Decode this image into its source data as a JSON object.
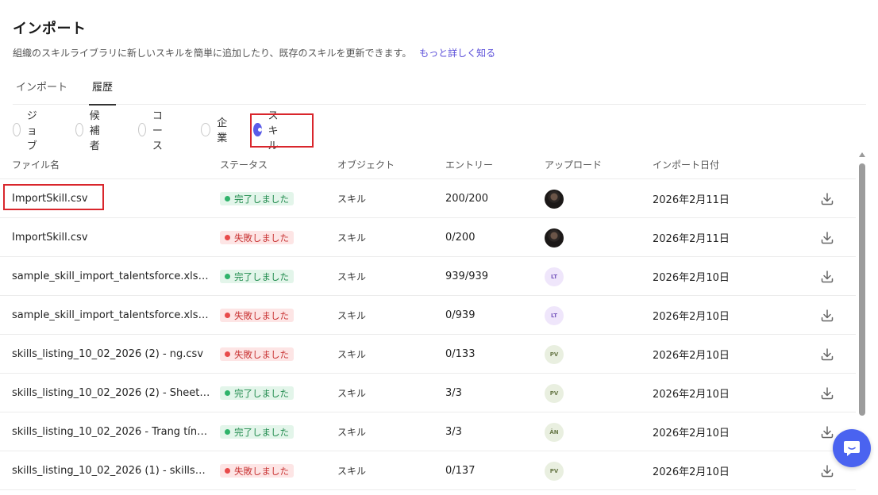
{
  "header": {
    "title": "インポート",
    "subtitle": "組織のスキルライブラリに新しいスキルを簡単に追加したり、既存のスキルを更新できます。",
    "learn_more": "もっと詳しく知る"
  },
  "tabs": [
    {
      "label": "インポート",
      "active": false
    },
    {
      "label": "履歴",
      "active": true
    }
  ],
  "filters": [
    {
      "label": "ジョブ",
      "checked": false
    },
    {
      "label": "候補者",
      "checked": false
    },
    {
      "label": "コース",
      "checked": false
    },
    {
      "label": "企業",
      "checked": false
    },
    {
      "label": "スキル",
      "checked": true
    }
  ],
  "table": {
    "columns": [
      "ファイル名",
      "ステータス",
      "オブジェクト",
      "エントリー",
      "アップロード",
      "インポート日付"
    ],
    "rows": [
      {
        "file": "ImportSkill.csv",
        "status": "完了しました",
        "status_type": "success",
        "object": "スキル",
        "entries": "200/200",
        "uploader": "",
        "avatar": "photo",
        "date": "2026年2月11日"
      },
      {
        "file": "ImportSkill.csv",
        "status": "失敗しました",
        "status_type": "fail",
        "object": "スキル",
        "entries": "0/200",
        "uploader": "",
        "avatar": "photo",
        "date": "2026年2月11日"
      },
      {
        "file": "sample_skill_import_talentsforce.xlsx ...",
        "status": "完了しました",
        "status_type": "success",
        "object": "スキル",
        "entries": "939/939",
        "uploader": "LT",
        "avatar": "lt",
        "date": "2026年2月10日"
      },
      {
        "file": "sample_skill_import_talentsforce.xlsx ...",
        "status": "失敗しました",
        "status_type": "fail",
        "object": "スキル",
        "entries": "0/939",
        "uploader": "LT",
        "avatar": "lt",
        "date": "2026年2月10日"
      },
      {
        "file": "skills_listing_10_02_2026 (2) - ng.csv",
        "status": "失敗しました",
        "status_type": "fail",
        "object": "スキル",
        "entries": "0/133",
        "uploader": "PV",
        "avatar": "pv",
        "date": "2026年2月10日"
      },
      {
        "file": "skills_listing_10_02_2026 (2) - Sheet1....",
        "status": "完了しました",
        "status_type": "success",
        "object": "スキル",
        "entries": "3/3",
        "uploader": "PV",
        "avatar": "pv",
        "date": "2026年2月10日"
      },
      {
        "file": "skills_listing_10_02_2026 - Trang tính1....",
        "status": "完了しました",
        "status_type": "success",
        "object": "スキル",
        "entries": "3/3",
        "uploader": "ÂN",
        "avatar": "an",
        "date": "2026年2月10日"
      },
      {
        "file": "skills_listing_10_02_2026 (1) - skills_lis...",
        "status": "失敗しました",
        "status_type": "fail",
        "object": "スキル",
        "entries": "0/137",
        "uploader": "PV",
        "avatar": "pv",
        "date": "2026年2月10日"
      }
    ]
  },
  "colors": {
    "accent": "#5b5ce8",
    "link": "#5b4fd9",
    "success": "#2fb36a",
    "fail": "#e84a4a",
    "highlight": "#d9262c",
    "chat": "#4a63f0"
  },
  "icons": {
    "download": "download-icon",
    "chat": "chat-bubble-icon"
  }
}
